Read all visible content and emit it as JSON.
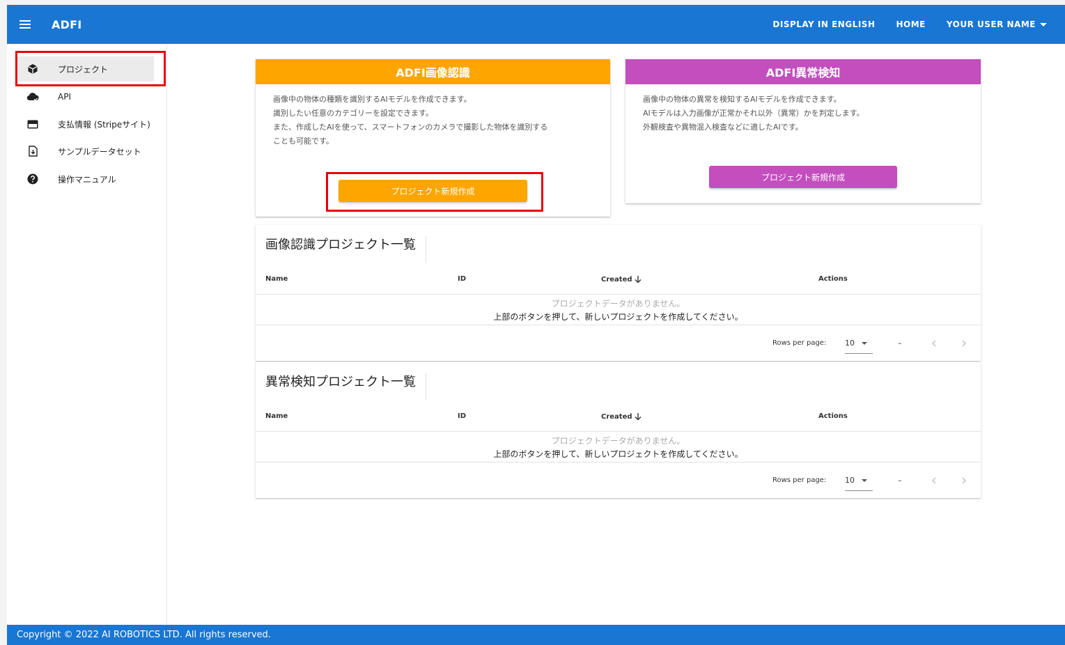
{
  "app": {
    "title": "ADFI"
  },
  "header": {
    "display_english": "DISPLAY IN ENGLISH",
    "home": "HOME",
    "user_name": "YOUR USER NAME"
  },
  "sidebar": {
    "items": [
      {
        "label": "プロジェクト",
        "icon": "cube-icon"
      },
      {
        "label": "API",
        "icon": "cloud-check-icon"
      },
      {
        "label": "支払情報 (Stripeサイト)",
        "icon": "credit-card-icon"
      },
      {
        "label": "サンプルデータセット",
        "icon": "file-download-icon"
      },
      {
        "label": "操作マニュアル",
        "icon": "help-circle-icon"
      }
    ]
  },
  "cards": {
    "image_recognition": {
      "title": "ADFI画像認識",
      "lines": [
        "画像中の物体の種類を識別するAIモデルを作成できます。",
        "識別したい任意のカテゴリーを設定できます。",
        "また、作成したAIを使って、スマートフォンのカメラで撮影した物体を識別する",
        "ことも可能です。"
      ],
      "button": "プロジェクト新規作成",
      "color": "#ffa500"
    },
    "anomaly_detection": {
      "title": "ADFI異常検知",
      "lines": [
        "画像中の物体の異常を検知するAIモデルを作成できます。",
        "AIモデルは入力画像が正常かそれ以外（異常）かを判定します。",
        "外観検査や異物混入検査などに適したAIです。"
      ],
      "button": "プロジェクト新規作成",
      "color": "#c34fbe"
    }
  },
  "tables": {
    "image_recognition": {
      "title": "画像認識プロジェクト一覧",
      "columns": [
        "Name",
        "ID",
        "Created",
        "Actions"
      ],
      "empty_line1": "プロジェクトデータがありません。",
      "empty_line2": "上部のボタンを押して、新しいプロジェクトを作成してください。",
      "rows_per_page_label": "Rows per page:",
      "rows_per_page": "10",
      "range": "–"
    },
    "anomaly_detection": {
      "title": "異常検知プロジェクト一覧",
      "columns": [
        "Name",
        "ID",
        "Created",
        "Actions"
      ],
      "empty_line1": "プロジェクトデータがありません。",
      "empty_line2": "上部のボタンを押して、新しいプロジェクトを作成してください。",
      "rows_per_page_label": "Rows per page:",
      "rows_per_page": "10",
      "range": "–"
    }
  },
  "footer": {
    "copyright": "Copyright © 2022 AI ROBOTICS LTD. All rights reserved."
  },
  "colors": {
    "primary": "#1976d2",
    "highlight": "#e8000b"
  }
}
